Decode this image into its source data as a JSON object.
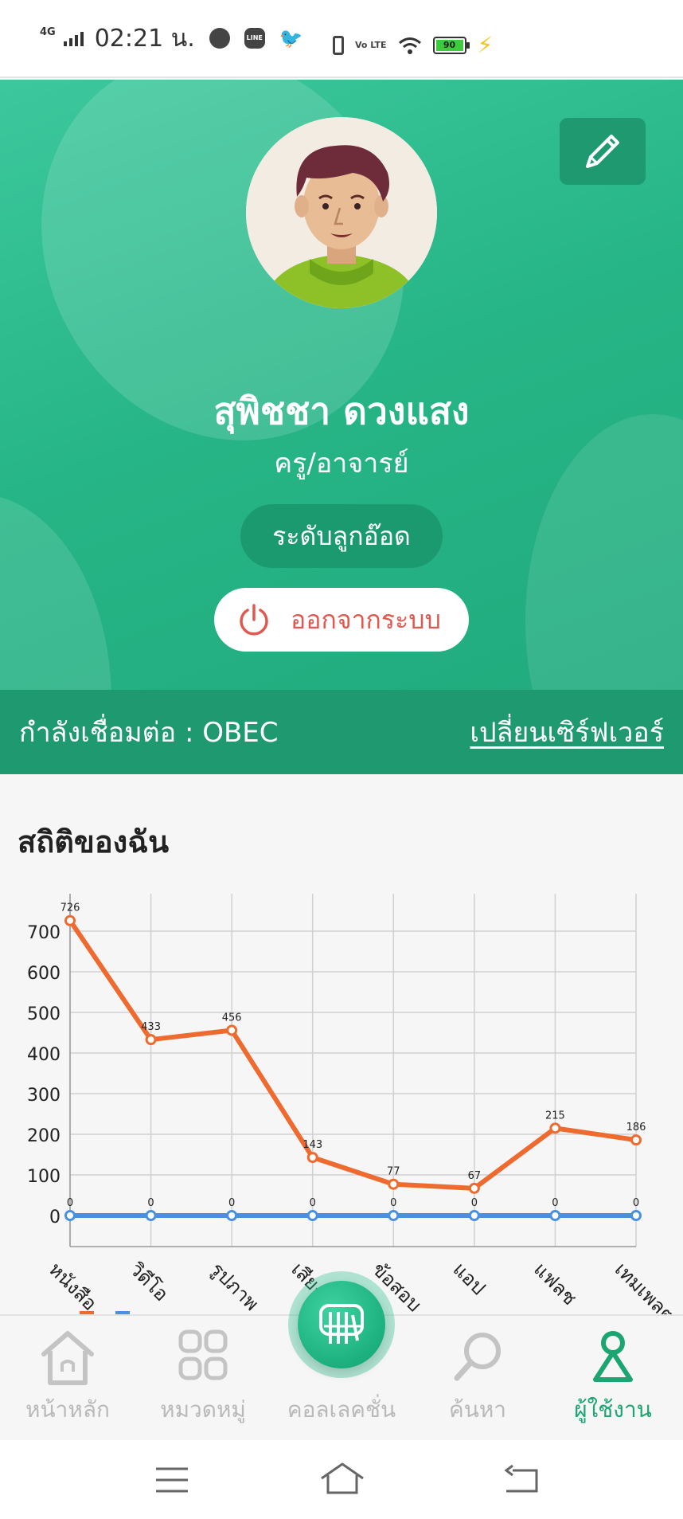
{
  "status_bar": {
    "network": "4G",
    "time": "02:21 น.",
    "battery": "90",
    "volte": "Vo LTE"
  },
  "profile": {
    "name": "สุพิชชา ดวงแสง",
    "role": "ครู/อาจารย์",
    "level": "ระดับลูกอ๊อด",
    "logout_label": "ออกจากระบบ",
    "server_label": "กำลังเชื่อมต่อ : OBEC",
    "change_server_label": "เปลี่ยนเซิร์ฟเวอร์"
  },
  "stats": {
    "title": "สถิติของฉัน"
  },
  "colors": {
    "brand_green": "#26b586",
    "dark_green": "#1f9a70",
    "series_orange": "#ee6a2f",
    "series_blue": "#4a90e2",
    "logout_red": "#e0584f"
  },
  "chart_data": {
    "type": "line",
    "categories": [
      "หนังสือ",
      "วิดีโอ",
      "รูปภาพ",
      "เสียง",
      "ข้อสอบ",
      "แอป",
      "แฟลช",
      "เทมเพลต"
    ],
    "series": [
      {
        "values": [
          726,
          433,
          456,
          143,
          77,
          67,
          215,
          186
        ],
        "color": "#ee6a2f"
      },
      {
        "values": [
          0,
          0,
          0,
          0,
          0,
          0,
          0,
          0
        ],
        "color": "#4a90e2"
      }
    ],
    "yticks": [
      0,
      100,
      200,
      300,
      400,
      500,
      600,
      700
    ],
    "ylim": [
      -70,
      800
    ],
    "grid": true,
    "data_labels": true
  },
  "bottom_nav": {
    "items": [
      {
        "label": "หน้าหลัก",
        "icon": "home-icon"
      },
      {
        "label": "หมวดหมู่",
        "icon": "category-grid-icon"
      },
      {
        "label": "คอลเลคชั่น",
        "icon": "collection-icon"
      },
      {
        "label": "ค้นหา",
        "icon": "search-icon"
      },
      {
        "label": "ผู้ใช้งาน",
        "icon": "user-icon"
      }
    ]
  }
}
